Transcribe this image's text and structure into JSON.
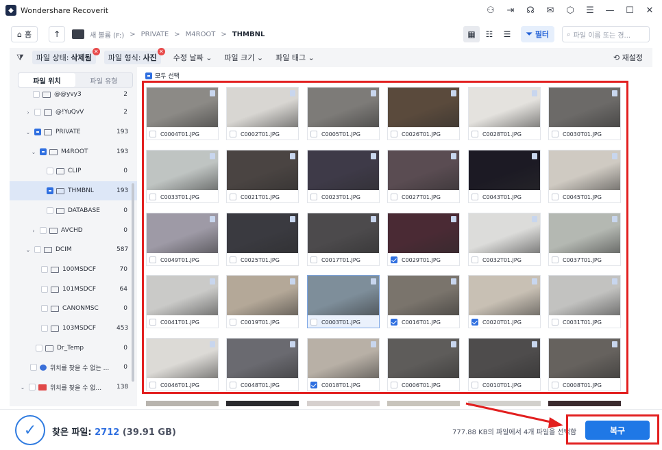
{
  "app": {
    "title": "Wondershare Recoverit"
  },
  "nav": {
    "home_label": "홈",
    "crumbs": [
      "새 볼륨 (F:)",
      "PRIVATE",
      "M4ROOT",
      "THMBNL"
    ],
    "filter_label": "필터",
    "search_placeholder": "파일 이름 또는 경..."
  },
  "filters": {
    "status_label": "파일 상태:",
    "status_value": "삭제됨",
    "type_label": "파일 형식:",
    "type_value": "사진",
    "date": "수정 날짜",
    "size": "파일 크기",
    "tag": "파일 태그",
    "reset": "재설정"
  },
  "sidebar": {
    "tabs": [
      "파일 위치",
      "파일 유형"
    ],
    "items": [
      {
        "label": "@@yvy3",
        "count": "2"
      },
      {
        "label": "@!YuQvV",
        "count": "2"
      },
      {
        "label": "PRIVATE",
        "count": "193"
      },
      {
        "label": "M4ROOT",
        "count": "193"
      },
      {
        "label": "CLIP",
        "count": "0"
      },
      {
        "label": "THMBNL",
        "count": "193"
      },
      {
        "label": "DATABASE",
        "count": "0"
      },
      {
        "label": "AVCHD",
        "count": "0"
      },
      {
        "label": "DCIM",
        "count": "587"
      },
      {
        "label": "100MSDCF",
        "count": "70"
      },
      {
        "label": "101MSDCF",
        "count": "64"
      },
      {
        "label": "CANONMSC",
        "count": "0"
      },
      {
        "label": "103MSDCF",
        "count": "453"
      },
      {
        "label": "Dr_Temp",
        "count": "0"
      },
      {
        "label": "위치를 찾을 수 없는 ...",
        "count": "0"
      },
      {
        "label": "위치를 찾을 수 없...",
        "count": "138"
      }
    ]
  },
  "content": {
    "select_all": "모두 선택",
    "files": [
      {
        "name": "C0004T01.JPG",
        "checked": false,
        "color": "#8c8a86"
      },
      {
        "name": "C0002T01.JPG",
        "checked": false,
        "color": "#d8d6d2"
      },
      {
        "name": "C0005T01.JPG",
        "checked": false,
        "color": "#7d7b78"
      },
      {
        "name": "C0026T01.JPG",
        "checked": false,
        "color": "#5a4a3c"
      },
      {
        "name": "C0028T01.JPG",
        "checked": false,
        "color": "#e4e2de"
      },
      {
        "name": "C0030T01.JPG",
        "checked": false,
        "color": "#6c6a68"
      },
      {
        "name": "C0033T01.JPG",
        "checked": false,
        "color": "#bfc4c2"
      },
      {
        "name": "C0021T01.JPG",
        "checked": false,
        "color": "#4a4442"
      },
      {
        "name": "C0023T01.JPG",
        "checked": false,
        "color": "#3e3a48"
      },
      {
        "name": "C0027T01.JPG",
        "checked": false,
        "color": "#5a4c52"
      },
      {
        "name": "C0043T01.JPG",
        "checked": false,
        "color": "#1c1a24"
      },
      {
        "name": "C0045T01.JPG",
        "checked": false,
        "color": "#cfcac2"
      },
      {
        "name": "C0049T01.JPG",
        "checked": false,
        "color": "#9e9aa6"
      },
      {
        "name": "C0025T01.JPG",
        "checked": false,
        "color": "#3a3a40"
      },
      {
        "name": "C0017T01.JPG",
        "checked": false,
        "color": "#4c4a4c"
      },
      {
        "name": "C0029T01.JPG",
        "checked": true,
        "color": "#4a2a34"
      },
      {
        "name": "C0032T01.JPG",
        "checked": false,
        "color": "#dcdcda"
      },
      {
        "name": "C0037T01.JPG",
        "checked": false,
        "color": "#b4b8b2"
      },
      {
        "name": "C0041T01.JPG",
        "checked": false,
        "color": "#cacac8"
      },
      {
        "name": "C0019T01.JPG",
        "checked": false,
        "color": "#b4a898"
      },
      {
        "name": "C0003T01.JPG",
        "checked": false,
        "color": "#7e8e9a"
      },
      {
        "name": "C0016T01.JPG",
        "checked": true,
        "color": "#7a746c"
      },
      {
        "name": "C0020T01.JPG",
        "checked": true,
        "color": "#c8c0b4"
      },
      {
        "name": "C0031T01.JPG",
        "checked": false,
        "color": "#c2c2c0"
      },
      {
        "name": "C0046T01.JPG",
        "checked": false,
        "color": "#dcdad6"
      },
      {
        "name": "C0048T01.JPG",
        "checked": false,
        "color": "#6a6a70"
      },
      {
        "name": "C0018T01.JPG",
        "checked": true,
        "color": "#b8b0a6"
      },
      {
        "name": "C0006T01.JPG",
        "checked": false,
        "color": "#5e5c5a"
      },
      {
        "name": "C0010T01.JPG",
        "checked": false,
        "color": "#4e4c4c"
      },
      {
        "name": "C0008T01.JPG",
        "checked": false,
        "color": "#66625e"
      }
    ]
  },
  "bottom": {
    "found_label": "찾은 파일:",
    "found_count": "2712",
    "found_size": "(39.91 GB)",
    "selection_status": "777.88 KB의 파일에서 4개 파일을 선택함",
    "recover_label": "복구"
  },
  "colors": {
    "accent": "#1f78e6",
    "annotation": "#e21f1f"
  }
}
